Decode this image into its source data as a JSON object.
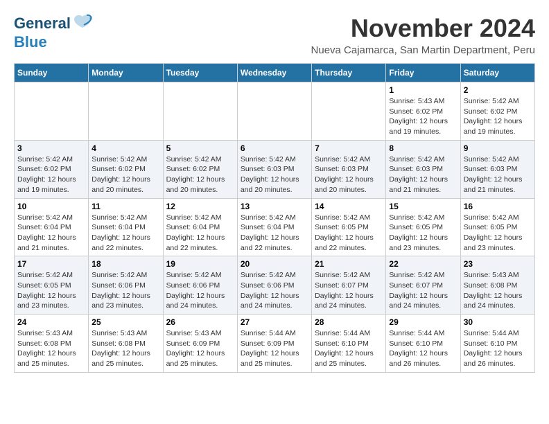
{
  "logo": {
    "line1": "General",
    "line2": "Blue"
  },
  "title": "November 2024",
  "subtitle": "Nueva Cajamarca, San Martin Department, Peru",
  "days_of_week": [
    "Sunday",
    "Monday",
    "Tuesday",
    "Wednesday",
    "Thursday",
    "Friday",
    "Saturday"
  ],
  "weeks": [
    [
      {
        "day": "",
        "info": ""
      },
      {
        "day": "",
        "info": ""
      },
      {
        "day": "",
        "info": ""
      },
      {
        "day": "",
        "info": ""
      },
      {
        "day": "",
        "info": ""
      },
      {
        "day": "1",
        "info": "Sunrise: 5:43 AM\nSunset: 6:02 PM\nDaylight: 12 hours and 19 minutes."
      },
      {
        "day": "2",
        "info": "Sunrise: 5:42 AM\nSunset: 6:02 PM\nDaylight: 12 hours and 19 minutes."
      }
    ],
    [
      {
        "day": "3",
        "info": "Sunrise: 5:42 AM\nSunset: 6:02 PM\nDaylight: 12 hours and 19 minutes."
      },
      {
        "day": "4",
        "info": "Sunrise: 5:42 AM\nSunset: 6:02 PM\nDaylight: 12 hours and 20 minutes."
      },
      {
        "day": "5",
        "info": "Sunrise: 5:42 AM\nSunset: 6:02 PM\nDaylight: 12 hours and 20 minutes."
      },
      {
        "day": "6",
        "info": "Sunrise: 5:42 AM\nSunset: 6:03 PM\nDaylight: 12 hours and 20 minutes."
      },
      {
        "day": "7",
        "info": "Sunrise: 5:42 AM\nSunset: 6:03 PM\nDaylight: 12 hours and 20 minutes."
      },
      {
        "day": "8",
        "info": "Sunrise: 5:42 AM\nSunset: 6:03 PM\nDaylight: 12 hours and 21 minutes."
      },
      {
        "day": "9",
        "info": "Sunrise: 5:42 AM\nSunset: 6:03 PM\nDaylight: 12 hours and 21 minutes."
      }
    ],
    [
      {
        "day": "10",
        "info": "Sunrise: 5:42 AM\nSunset: 6:04 PM\nDaylight: 12 hours and 21 minutes."
      },
      {
        "day": "11",
        "info": "Sunrise: 5:42 AM\nSunset: 6:04 PM\nDaylight: 12 hours and 22 minutes."
      },
      {
        "day": "12",
        "info": "Sunrise: 5:42 AM\nSunset: 6:04 PM\nDaylight: 12 hours and 22 minutes."
      },
      {
        "day": "13",
        "info": "Sunrise: 5:42 AM\nSunset: 6:04 PM\nDaylight: 12 hours and 22 minutes."
      },
      {
        "day": "14",
        "info": "Sunrise: 5:42 AM\nSunset: 6:05 PM\nDaylight: 12 hours and 22 minutes."
      },
      {
        "day": "15",
        "info": "Sunrise: 5:42 AM\nSunset: 6:05 PM\nDaylight: 12 hours and 23 minutes."
      },
      {
        "day": "16",
        "info": "Sunrise: 5:42 AM\nSunset: 6:05 PM\nDaylight: 12 hours and 23 minutes."
      }
    ],
    [
      {
        "day": "17",
        "info": "Sunrise: 5:42 AM\nSunset: 6:05 PM\nDaylight: 12 hours and 23 minutes."
      },
      {
        "day": "18",
        "info": "Sunrise: 5:42 AM\nSunset: 6:06 PM\nDaylight: 12 hours and 23 minutes."
      },
      {
        "day": "19",
        "info": "Sunrise: 5:42 AM\nSunset: 6:06 PM\nDaylight: 12 hours and 24 minutes."
      },
      {
        "day": "20",
        "info": "Sunrise: 5:42 AM\nSunset: 6:06 PM\nDaylight: 12 hours and 24 minutes."
      },
      {
        "day": "21",
        "info": "Sunrise: 5:42 AM\nSunset: 6:07 PM\nDaylight: 12 hours and 24 minutes."
      },
      {
        "day": "22",
        "info": "Sunrise: 5:42 AM\nSunset: 6:07 PM\nDaylight: 12 hours and 24 minutes."
      },
      {
        "day": "23",
        "info": "Sunrise: 5:43 AM\nSunset: 6:08 PM\nDaylight: 12 hours and 24 minutes."
      }
    ],
    [
      {
        "day": "24",
        "info": "Sunrise: 5:43 AM\nSunset: 6:08 PM\nDaylight: 12 hours and 25 minutes."
      },
      {
        "day": "25",
        "info": "Sunrise: 5:43 AM\nSunset: 6:08 PM\nDaylight: 12 hours and 25 minutes."
      },
      {
        "day": "26",
        "info": "Sunrise: 5:43 AM\nSunset: 6:09 PM\nDaylight: 12 hours and 25 minutes."
      },
      {
        "day": "27",
        "info": "Sunrise: 5:44 AM\nSunset: 6:09 PM\nDaylight: 12 hours and 25 minutes."
      },
      {
        "day": "28",
        "info": "Sunrise: 5:44 AM\nSunset: 6:10 PM\nDaylight: 12 hours and 25 minutes."
      },
      {
        "day": "29",
        "info": "Sunrise: 5:44 AM\nSunset: 6:10 PM\nDaylight: 12 hours and 26 minutes."
      },
      {
        "day": "30",
        "info": "Sunrise: 5:44 AM\nSunset: 6:10 PM\nDaylight: 12 hours and 26 minutes."
      }
    ]
  ]
}
